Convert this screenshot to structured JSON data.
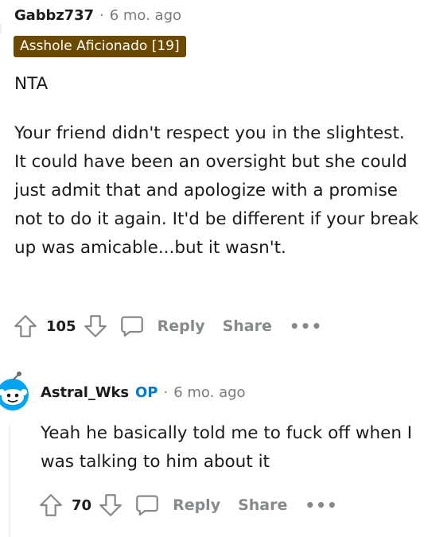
{
  "comment": {
    "username": "Gabbz737",
    "separator": "·",
    "timestamp": "6 mo. ago",
    "flair": "Asshole Aficionado [19]",
    "paragraphs": [
      "NTA",
      "Your friend didn't respect you in the slightest. It could have been an oversight but she could just admit that and apologize with a promise not to do it again. It'd be different if your break up was amicable...but it wasn't."
    ],
    "score": "105",
    "reply_label": "Reply",
    "share_label": "Share",
    "more_label": "•••"
  },
  "reply": {
    "username": "Astral_Wks",
    "op_badge": "OP",
    "separator": "·",
    "timestamp": "6 mo. ago",
    "text": "Yeah he basically told me to fuck off when I was talking to him about it",
    "score": "70",
    "reply_label": "Reply",
    "share_label": "Share",
    "more_label": "•••"
  },
  "icons": {
    "upvote": "upvote-icon",
    "downvote": "downvote-icon",
    "reply": "comment-bubble-icon",
    "avatar": "snoo-avatar-icon"
  },
  "colors": {
    "flair_bg": "#6b4a00",
    "op": "#0079d3",
    "muted": "#878a8c",
    "avatar_blue": "#00a6f5"
  }
}
